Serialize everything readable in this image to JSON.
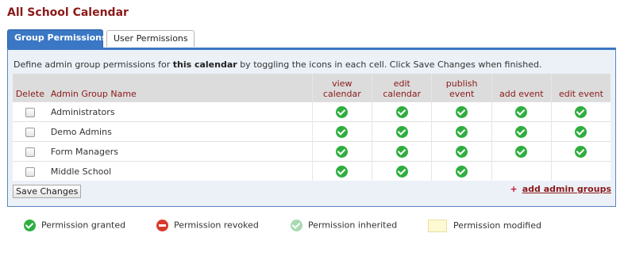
{
  "page": {
    "title": "All School Calendar"
  },
  "tabs": [
    {
      "label": "Group Permissions",
      "active": true
    },
    {
      "label": "User Permissions",
      "active": false
    }
  ],
  "description": {
    "before": "Define admin group permissions for ",
    "bold": "this calendar",
    "after": " by toggling the icons in each cell. Click Save Changes when finished."
  },
  "table": {
    "headers": {
      "delete": "Delete",
      "name": "Admin Group Name",
      "perms": [
        [
          "view",
          "calendar"
        ],
        [
          "edit",
          "calendar"
        ],
        [
          "publish",
          "event"
        ],
        [
          "",
          "add event"
        ],
        [
          "",
          "edit event"
        ]
      ]
    },
    "rows": [
      {
        "name": "Administrators",
        "perms": [
          "granted",
          "granted",
          "granted",
          "granted",
          "granted"
        ]
      },
      {
        "name": "Demo Admins",
        "perms": [
          "granted",
          "granted",
          "granted",
          "granted",
          "granted"
        ]
      },
      {
        "name": "Form Managers",
        "perms": [
          "granted",
          "granted",
          "granted",
          "granted",
          "granted"
        ]
      },
      {
        "name": "Middle School",
        "perms": [
          "granted",
          "granted",
          "granted",
          "none",
          "none"
        ]
      }
    ]
  },
  "actions": {
    "save_label": "Save Changes",
    "add_plus": "+",
    "add_label": "add admin groups"
  },
  "legend": {
    "granted": "Permission granted",
    "revoked": "Permission revoked",
    "inherited": "Permission inherited",
    "modified": "Permission modified"
  },
  "colors": {
    "title": "#8b1a1a",
    "tab_active": "#3a77c4",
    "granted": "#2fae3f",
    "revoked": "#d93a2b",
    "inherited": "#a9d9b1",
    "modified": "#fdf9d2"
  }
}
